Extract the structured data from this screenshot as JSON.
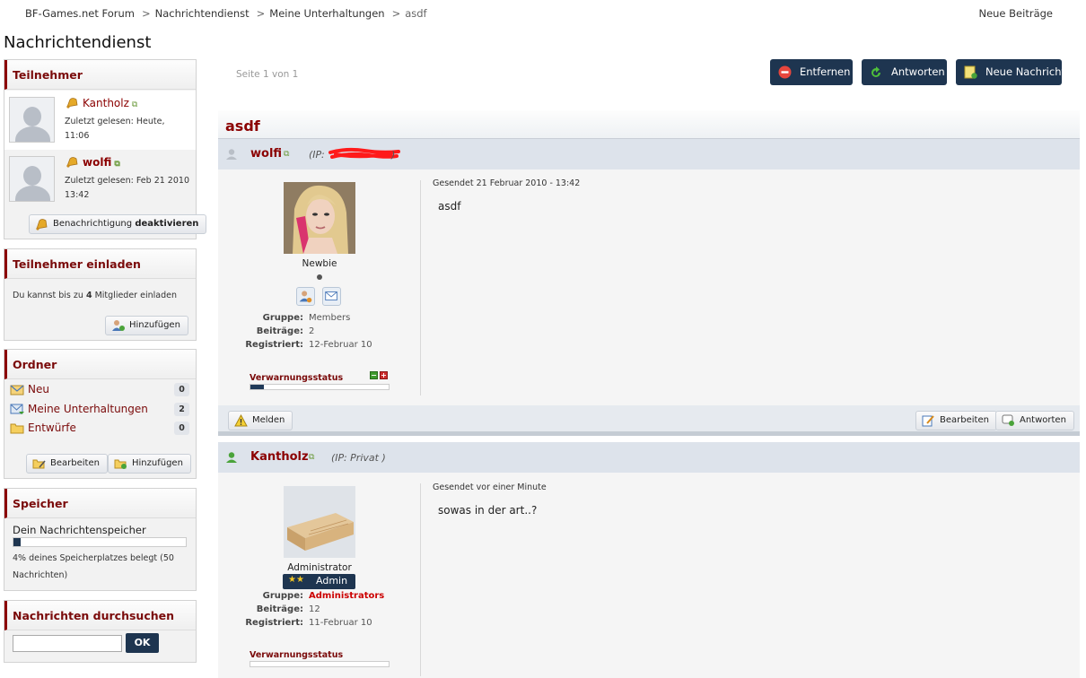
{
  "breadcrumb": {
    "items": [
      "BF-Games.net Forum",
      "Nachrichtendienst",
      "Meine Unterhaltungen"
    ],
    "current": "asdf"
  },
  "top_links": {
    "new_posts": "Neue Beiträge"
  },
  "page_title": "Nachrichtendienst",
  "participants": {
    "title": "Teilnehmer",
    "list": [
      {
        "name": "Kantholz",
        "last_read": "Zuletzt gelesen: Heute, 11:06"
      },
      {
        "name": "wolfi",
        "last_read": "Zuletzt gelesen: Feb 21 2010 13:42"
      }
    ],
    "notify_prefix": "Benachrichtigung",
    "notify_action": "deaktivieren"
  },
  "invite": {
    "title": "Teilnehmer einladen",
    "text_prefix": "Du kannst bis zu",
    "count": "4",
    "text_suffix": "Mitglieder einladen",
    "add_label": "Hinzufügen"
  },
  "folders": {
    "title": "Ordner",
    "items": [
      {
        "label": "Neu",
        "count": "0"
      },
      {
        "label": "Meine Unterhaltungen",
        "count": "2"
      },
      {
        "label": "Entwürfe",
        "count": "0"
      }
    ],
    "edit_label": "Bearbeiten",
    "add_label": "Hinzufügen"
  },
  "storage": {
    "title": "Speicher",
    "label": "Dein Nachrichtenspeicher",
    "used_percent": 4,
    "text": "4% deines Speicherplatzes belegt (50 Nachrichten)"
  },
  "search": {
    "title": "Nachrichten durchsuchen",
    "value": "",
    "button": "OK"
  },
  "toolbar": {
    "pages": "Seite 1 von 1",
    "remove": "Entfernen",
    "reply": "Antworten",
    "new_message": "Neue Nachricht"
  },
  "conversation": {
    "title": "asdf",
    "posts": [
      {
        "author": "wolfi",
        "ip": "(IP: ",
        "ip_tail": ")",
        "rank": "Newbie",
        "group_label": "Gruppe:",
        "group": "Members",
        "posts_label": "Beiträge:",
        "posts": "2",
        "registered_label": "Registriert:",
        "registered": "12-Februar 10",
        "warn_label": "Verwarnungsstatus",
        "warn_level": 0.1,
        "sent": "Gesendet 21 Februar 2010 - 13:42",
        "text": "asdf",
        "report": "Melden",
        "edit": "Bearbeiten",
        "reply": "Antworten"
      },
      {
        "author": "Kantholz",
        "ip": "(IP: Privat )",
        "rank": "Administrator",
        "badge": "Admin",
        "group_label": "Gruppe:",
        "group": "Administrators",
        "posts_label": "Beiträge:",
        "posts": "12",
        "registered_label": "Registriert:",
        "registered": "11-Februar 10",
        "warn_label": "Verwarnungsstatus",
        "warn_level": 0,
        "sent": "Gesendet vor einer Minute",
        "text": "sowas in der art..?"
      }
    ]
  },
  "colors": {
    "accent": "#8b0000",
    "button_dark": "#1e3550",
    "admin_group": "#cc0000"
  }
}
